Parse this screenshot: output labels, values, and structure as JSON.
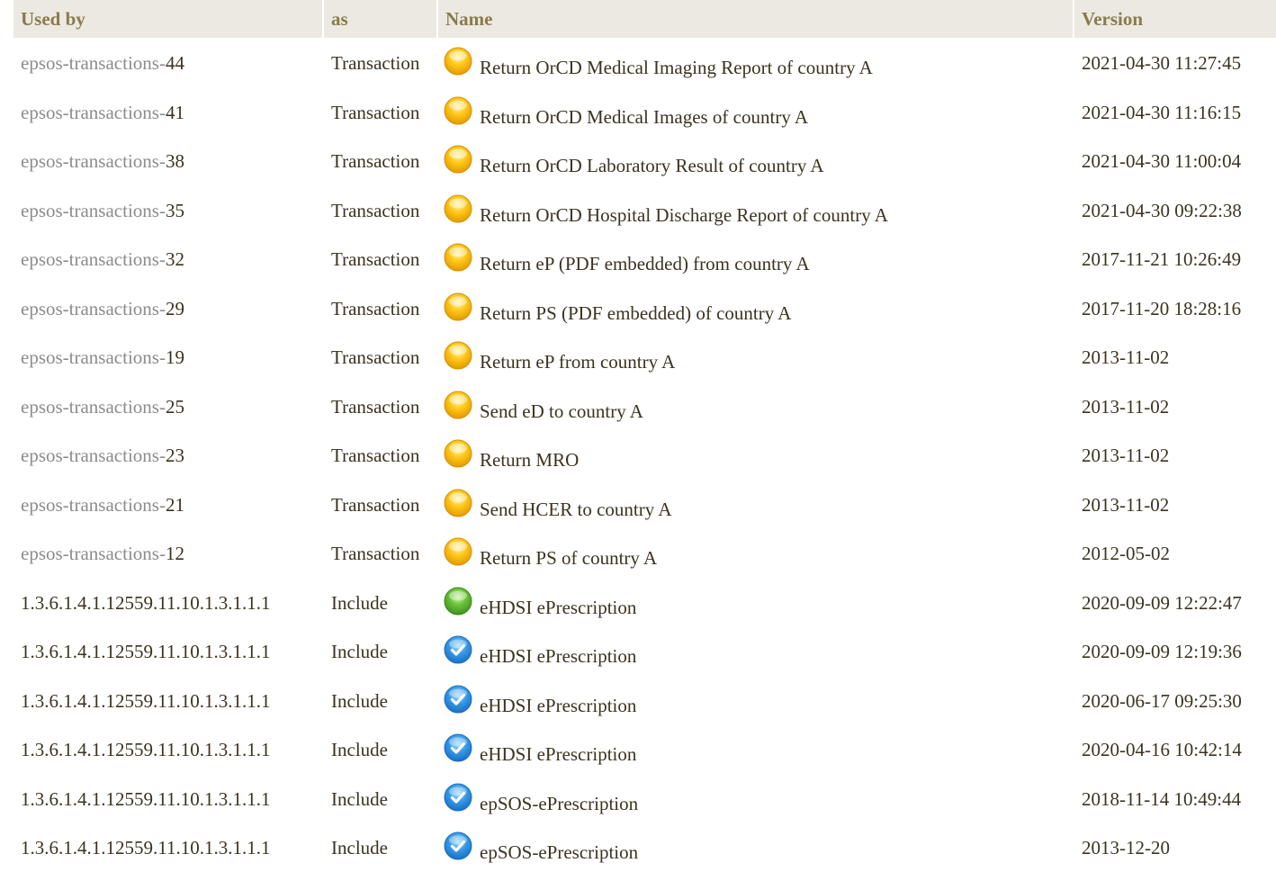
{
  "header": {
    "used_by": "Used by",
    "as": "as",
    "name": "Name",
    "version": "Version"
  },
  "colors": {
    "header_bg": "#ece9e2",
    "header_text": "#8a7b4e",
    "link_prefix": "#8c8c8c",
    "status_draft": "#f5b800",
    "status_active": "#5cb82e",
    "status_final": "#2f8fd8"
  },
  "rows": [
    {
      "used_by_prefix": "epsos-transactions-",
      "used_by_suffix": "44",
      "as": "Transaction",
      "status_icon": "draft-status-icon",
      "name": "Return OrCD Medical Imaging Report of country A",
      "version": "2021-04-30 11:27:45"
    },
    {
      "used_by_prefix": "epsos-transactions-",
      "used_by_suffix": "41",
      "as": "Transaction",
      "status_icon": "draft-status-icon",
      "name": "Return OrCD Medical Images of country A",
      "version": "2021-04-30 11:16:15"
    },
    {
      "used_by_prefix": "epsos-transactions-",
      "used_by_suffix": "38",
      "as": "Transaction",
      "status_icon": "draft-status-icon",
      "name": "Return OrCD Laboratory Result of country A",
      "version": "2021-04-30 11:00:04"
    },
    {
      "used_by_prefix": "epsos-transactions-",
      "used_by_suffix": "35",
      "as": "Transaction",
      "status_icon": "draft-status-icon",
      "name": "Return OrCD Hospital Discharge Report of country A",
      "version": "2021-04-30 09:22:38"
    },
    {
      "used_by_prefix": "epsos-transactions-",
      "used_by_suffix": "32",
      "as": "Transaction",
      "status_icon": "draft-status-icon",
      "name": "Return eP (PDF embedded) from country A",
      "version": "2017-11-21 10:26:49"
    },
    {
      "used_by_prefix": "epsos-transactions-",
      "used_by_suffix": "29",
      "as": "Transaction",
      "status_icon": "draft-status-icon",
      "name": "Return PS (PDF embedded) of country A",
      "version": "2017-11-20 18:28:16"
    },
    {
      "used_by_prefix": "epsos-transactions-",
      "used_by_suffix": "19",
      "as": "Transaction",
      "status_icon": "draft-status-icon",
      "name": "Return eP from country A",
      "version": "2013-11-02"
    },
    {
      "used_by_prefix": "epsos-transactions-",
      "used_by_suffix": "25",
      "as": "Transaction",
      "status_icon": "draft-status-icon",
      "name": "Send eD to country A",
      "version": "2013-11-02"
    },
    {
      "used_by_prefix": "epsos-transactions-",
      "used_by_suffix": "23",
      "as": "Transaction",
      "status_icon": "draft-status-icon",
      "name": "Return MRO",
      "version": "2013-11-02"
    },
    {
      "used_by_prefix": "epsos-transactions-",
      "used_by_suffix": "21",
      "as": "Transaction",
      "status_icon": "draft-status-icon",
      "name": "Send HCER to country A",
      "version": "2013-11-02"
    },
    {
      "used_by_prefix": "epsos-transactions-",
      "used_by_suffix": "12",
      "as": "Transaction",
      "status_icon": "draft-status-icon",
      "name": "Return PS of country A",
      "version": "2012-05-02"
    },
    {
      "used_by_prefix": "",
      "used_by_suffix": "1.3.6.1.4.1.12559.11.10.1.3.1.1.1",
      "as": "Include",
      "status_icon": "active-status-icon",
      "name": "eHDSI ePrescription",
      "version": "2020-09-09 12:22:47"
    },
    {
      "used_by_prefix": "",
      "used_by_suffix": "1.3.6.1.4.1.12559.11.10.1.3.1.1.1",
      "as": "Include",
      "status_icon": "final-status-icon",
      "name": "eHDSI ePrescription",
      "version": "2020-09-09 12:19:36"
    },
    {
      "used_by_prefix": "",
      "used_by_suffix": "1.3.6.1.4.1.12559.11.10.1.3.1.1.1",
      "as": "Include",
      "status_icon": "final-status-icon",
      "name": "eHDSI ePrescription",
      "version": "2020-06-17 09:25:30"
    },
    {
      "used_by_prefix": "",
      "used_by_suffix": "1.3.6.1.4.1.12559.11.10.1.3.1.1.1",
      "as": "Include",
      "status_icon": "final-status-icon",
      "name": "eHDSI ePrescription",
      "version": "2020-04-16 10:42:14"
    },
    {
      "used_by_prefix": "",
      "used_by_suffix": "1.3.6.1.4.1.12559.11.10.1.3.1.1.1",
      "as": "Include",
      "status_icon": "final-status-icon",
      "name": "epSOS-ePrescription",
      "version": "2018-11-14 10:49:44"
    },
    {
      "used_by_prefix": "",
      "used_by_suffix": "1.3.6.1.4.1.12559.11.10.1.3.1.1.1",
      "as": "Include",
      "status_icon": "final-status-icon",
      "name": "epSOS-ePrescription",
      "version": "2013-12-20"
    }
  ]
}
